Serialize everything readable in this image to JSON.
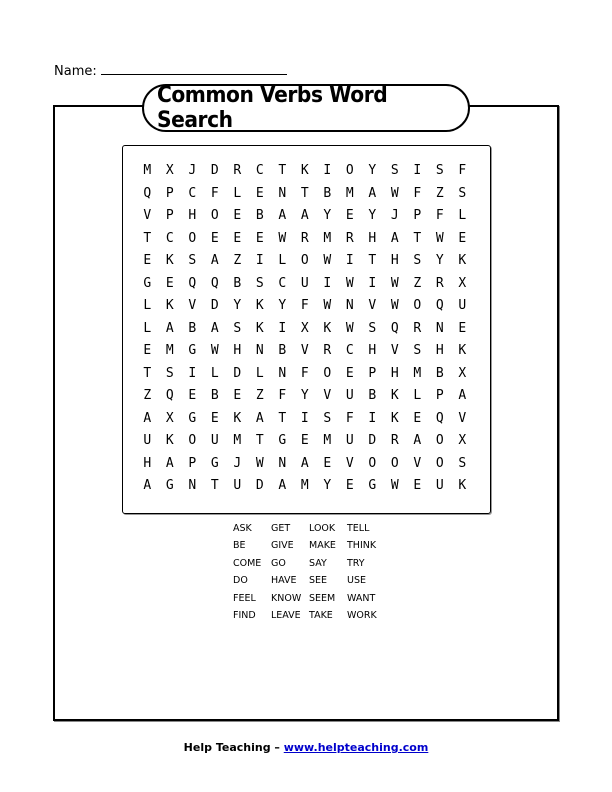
{
  "name_label": "Name:",
  "title": "Common Verbs Word Search",
  "grid": [
    [
      "M",
      "X",
      "J",
      "D",
      "R",
      "C",
      "T",
      "K",
      "I",
      "O",
      "Y",
      "S",
      "I",
      "S",
      "F"
    ],
    [
      "Q",
      "P",
      "C",
      "F",
      "L",
      "E",
      "N",
      "T",
      "B",
      "M",
      "A",
      "W",
      "F",
      "Z",
      "S"
    ],
    [
      "V",
      "P",
      "H",
      "O",
      "E",
      "B",
      "A",
      "A",
      "Y",
      "E",
      "Y",
      "J",
      "P",
      "F",
      "L"
    ],
    [
      "T",
      "C",
      "O",
      "E",
      "E",
      "E",
      "W",
      "R",
      "M",
      "R",
      "H",
      "A",
      "T",
      "W",
      "E"
    ],
    [
      "E",
      "K",
      "S",
      "A",
      "Z",
      "I",
      "L",
      "O",
      "W",
      "I",
      "T",
      "H",
      "S",
      "Y",
      "K"
    ],
    [
      "G",
      "E",
      "Q",
      "Q",
      "B",
      "S",
      "C",
      "U",
      "I",
      "W",
      "I",
      "W",
      "Z",
      "R",
      "X"
    ],
    [
      "L",
      "K",
      "V",
      "D",
      "Y",
      "K",
      "Y",
      "F",
      "W",
      "N",
      "V",
      "W",
      "O",
      "Q",
      "U"
    ],
    [
      "L",
      "A",
      "B",
      "A",
      "S",
      "K",
      "I",
      "X",
      "K",
      "W",
      "S",
      "Q",
      "R",
      "N",
      "E"
    ],
    [
      "E",
      "M",
      "G",
      "W",
      "H",
      "N",
      "B",
      "V",
      "R",
      "C",
      "H",
      "V",
      "S",
      "H",
      "K"
    ],
    [
      "T",
      "S",
      "I",
      "L",
      "D",
      "L",
      "N",
      "F",
      "O",
      "E",
      "P",
      "H",
      "M",
      "B",
      "X"
    ],
    [
      "Z",
      "Q",
      "E",
      "B",
      "E",
      "Z",
      "F",
      "Y",
      "V",
      "U",
      "B",
      "K",
      "L",
      "P",
      "A"
    ],
    [
      "A",
      "X",
      "G",
      "E",
      "K",
      "A",
      "T",
      "I",
      "S",
      "F",
      "I",
      "K",
      "E",
      "Q",
      "V"
    ],
    [
      "U",
      "K",
      "O",
      "U",
      "M",
      "T",
      "G",
      "E",
      "M",
      "U",
      "D",
      "R",
      "A",
      "O",
      "X"
    ],
    [
      "H",
      "A",
      "P",
      "G",
      "J",
      "W",
      "N",
      "A",
      "E",
      "V",
      "O",
      "O",
      "V",
      "O",
      "S"
    ],
    [
      "A",
      "G",
      "N",
      "T",
      "U",
      "D",
      "A",
      "M",
      "Y",
      "E",
      "G",
      "W",
      "E",
      "U",
      "K"
    ]
  ],
  "word_list": [
    [
      "ASK",
      "GET",
      "LOOK",
      "TELL"
    ],
    [
      "BE",
      "GIVE",
      "MAKE",
      "THINK"
    ],
    [
      "COME",
      "GO",
      "SAY",
      "TRY"
    ],
    [
      "DO",
      "HAVE",
      "SEE",
      "USE"
    ],
    [
      "FEEL",
      "KNOW",
      "SEEM",
      "WANT"
    ],
    [
      "FIND",
      "LEAVE",
      "TAKE",
      "WORK"
    ]
  ],
  "footer": {
    "text": "Help Teaching – ",
    "link_text": "www.helpteaching.com"
  }
}
